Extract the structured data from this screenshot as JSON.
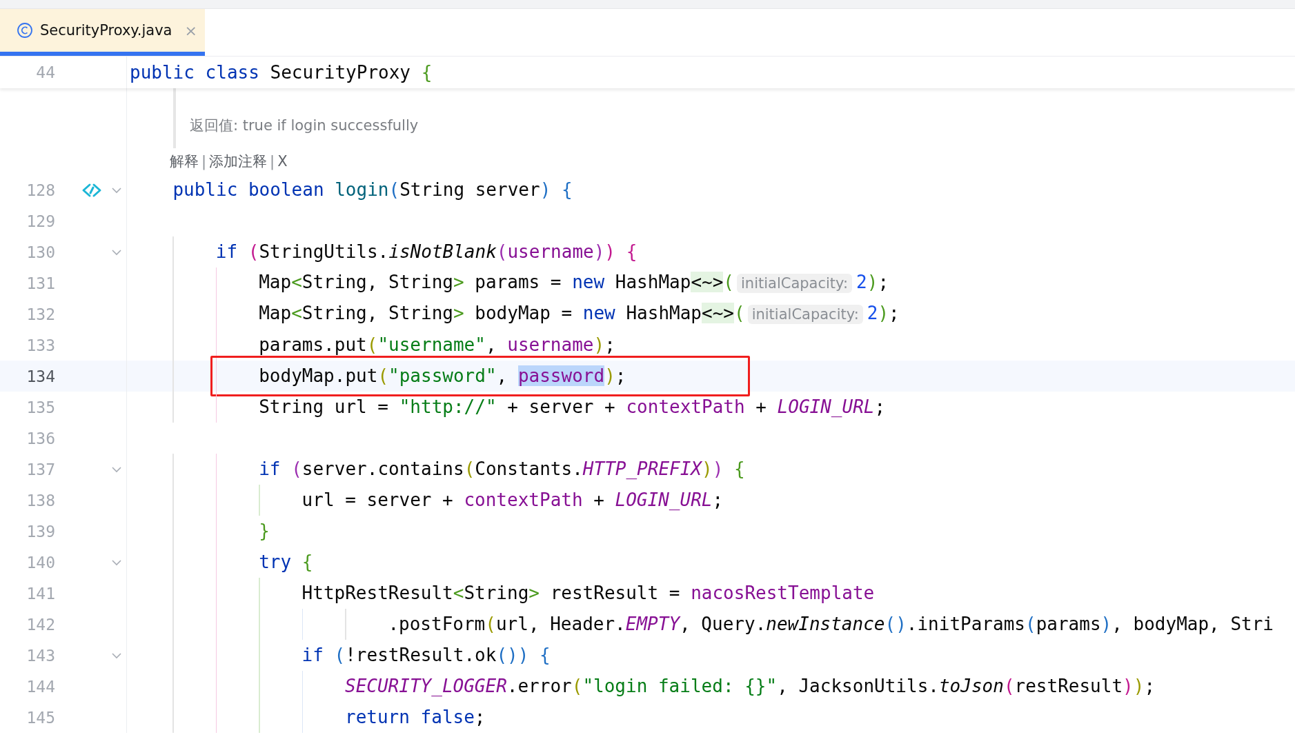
{
  "tabs": [
    {
      "label": "SecurityProxy.java",
      "selected": true,
      "close": "×"
    }
  ],
  "sticky_line": {
    "number": "44",
    "tokens": [
      {
        "text": "public ",
        "kind": "kw"
      },
      {
        "text": "class ",
        "kind": "kw"
      },
      {
        "text": "SecurityProxy ",
        "kind": "plain"
      },
      {
        "text": "{",
        "kind": "bgreen"
      }
    ]
  },
  "doc": {
    "text": "返回值: true if login successfully"
  },
  "inlay_actions": [
    {
      "text": "解释",
      "kind": "link"
    },
    {
      "text": "|",
      "kind": "sep"
    },
    {
      "text": "添加注释",
      "kind": "link"
    },
    {
      "text": "|",
      "kind": "sep"
    },
    {
      "text": "X",
      "kind": "link"
    }
  ],
  "rows": [
    {
      "number": "128",
      "fold": true,
      "marker": true,
      "current": false,
      "boxed": false,
      "tokens": [
        {
          "text": "    public ",
          "kind": "kw"
        },
        {
          "text": "boolean ",
          "kind": "kw"
        },
        {
          "text": "login",
          "kind": "fn"
        },
        {
          "text": "(",
          "kind": "bblue"
        },
        {
          "text": "String server",
          "kind": "plain"
        },
        {
          "text": ")",
          "kind": "bblue"
        },
        {
          "text": " {",
          "kind": "bblue"
        }
      ]
    },
    {
      "number": "129",
      "fold": false,
      "marker": false,
      "current": false,
      "boxed": false,
      "tokens": []
    },
    {
      "number": "130",
      "fold": true,
      "marker": false,
      "current": false,
      "boxed": false,
      "tokens": [
        {
          "text": "        if ",
          "kind": "kw"
        },
        {
          "text": "(",
          "kind": "bpink"
        },
        {
          "text": "StringUtils.",
          "kind": "plain"
        },
        {
          "text": "isNotBlank",
          "kind": "ital"
        },
        {
          "text": "(",
          "kind": "bpurple"
        },
        {
          "text": "username",
          "kind": "field"
        },
        {
          "text": ")",
          "kind": "bpurple"
        },
        {
          "text": ")",
          "kind": "bpink"
        },
        {
          "text": " {",
          "kind": "bpink"
        }
      ]
    },
    {
      "number": "131",
      "fold": false,
      "marker": false,
      "current": false,
      "boxed": false,
      "tokens": [
        {
          "text": "            Map",
          "kind": "plain"
        },
        {
          "text": "<",
          "kind": "bgreen"
        },
        {
          "text": "String, String",
          "kind": "plain"
        },
        {
          "text": ">",
          "kind": "bgreen"
        },
        {
          "text": " params = ",
          "kind": "plain"
        },
        {
          "text": "new ",
          "kind": "kw"
        },
        {
          "text": "HashMap",
          "kind": "plain"
        },
        {
          "text": "<~>",
          "kind": "diamond"
        },
        {
          "text": "(",
          "kind": "bgreen"
        },
        {
          "text": "initialCapacity:",
          "kind": "hint"
        },
        {
          "text": "2",
          "kind": "num"
        },
        {
          "text": ")",
          "kind": "bgreen"
        },
        {
          "text": ";",
          "kind": "plain"
        }
      ]
    },
    {
      "number": "132",
      "fold": false,
      "marker": false,
      "current": false,
      "boxed": false,
      "tokens": [
        {
          "text": "            Map",
          "kind": "plain"
        },
        {
          "text": "<",
          "kind": "bgreen"
        },
        {
          "text": "String, String",
          "kind": "plain"
        },
        {
          "text": ">",
          "kind": "bgreen"
        },
        {
          "text": " bodyMap = ",
          "kind": "plain"
        },
        {
          "text": "new ",
          "kind": "kw"
        },
        {
          "text": "HashMap",
          "kind": "plain"
        },
        {
          "text": "<~>",
          "kind": "diamond"
        },
        {
          "text": "(",
          "kind": "bgreen"
        },
        {
          "text": "initialCapacity:",
          "kind": "hint"
        },
        {
          "text": "2",
          "kind": "num"
        },
        {
          "text": ")",
          "kind": "bgreen"
        },
        {
          "text": ";",
          "kind": "plain"
        }
      ]
    },
    {
      "number": "133",
      "fold": false,
      "marker": false,
      "current": false,
      "boxed": false,
      "tokens": [
        {
          "text": "            params.put",
          "kind": "plain"
        },
        {
          "text": "(",
          "kind": "bolive"
        },
        {
          "text": "\"username\"",
          "kind": "str"
        },
        {
          "text": ", ",
          "kind": "plain"
        },
        {
          "text": "username",
          "kind": "field"
        },
        {
          "text": ")",
          "kind": "bolive"
        },
        {
          "text": ";",
          "kind": "plain"
        }
      ]
    },
    {
      "number": "134",
      "fold": false,
      "marker": false,
      "current": true,
      "boxed": true,
      "tokens": [
        {
          "text": "            bodyMap.put",
          "kind": "plain"
        },
        {
          "text": "(",
          "kind": "bolive"
        },
        {
          "text": "\"password\"",
          "kind": "str"
        },
        {
          "text": ", ",
          "kind": "plain"
        },
        {
          "text": "password",
          "kind": "sel"
        },
        {
          "text": ")",
          "kind": "bolive"
        },
        {
          "text": ";",
          "kind": "plain"
        }
      ]
    },
    {
      "number": "135",
      "fold": false,
      "marker": false,
      "current": false,
      "boxed": false,
      "tokens": [
        {
          "text": "            String url = ",
          "kind": "plain"
        },
        {
          "text": "\"http://\"",
          "kind": "str"
        },
        {
          "text": " + server + ",
          "kind": "plain"
        },
        {
          "text": "contextPath",
          "kind": "field"
        },
        {
          "text": " + ",
          "kind": "plain"
        },
        {
          "text": "LOGIN_URL",
          "kind": "konst"
        },
        {
          "text": ";",
          "kind": "plain"
        }
      ]
    },
    {
      "number": "136",
      "fold": false,
      "marker": false,
      "current": false,
      "boxed": false,
      "tokens": []
    },
    {
      "number": "137",
      "fold": true,
      "marker": false,
      "current": false,
      "boxed": false,
      "tokens": [
        {
          "text": "            if ",
          "kind": "kw"
        },
        {
          "text": "(",
          "kind": "bpurple"
        },
        {
          "text": "server.contains",
          "kind": "plain"
        },
        {
          "text": "(",
          "kind": "bolive"
        },
        {
          "text": "Constants.",
          "kind": "plain"
        },
        {
          "text": "HTTP_PREFIX",
          "kind": "konst"
        },
        {
          "text": ")",
          "kind": "bolive"
        },
        {
          "text": ")",
          "kind": "bpurple"
        },
        {
          "text": " {",
          "kind": "bgreen"
        }
      ]
    },
    {
      "number": "138",
      "fold": false,
      "marker": false,
      "current": false,
      "boxed": false,
      "tokens": [
        {
          "text": "                url = server + ",
          "kind": "plain"
        },
        {
          "text": "contextPath",
          "kind": "field"
        },
        {
          "text": " + ",
          "kind": "plain"
        },
        {
          "text": "LOGIN_URL",
          "kind": "konst"
        },
        {
          "text": ";",
          "kind": "plain"
        }
      ]
    },
    {
      "number": "139",
      "fold": false,
      "marker": false,
      "current": false,
      "boxed": false,
      "tokens": [
        {
          "text": "            }",
          "kind": "bgreen"
        }
      ]
    },
    {
      "number": "140",
      "fold": true,
      "marker": false,
      "current": false,
      "boxed": false,
      "tokens": [
        {
          "text": "            try ",
          "kind": "kw"
        },
        {
          "text": "{",
          "kind": "bgreen"
        }
      ]
    },
    {
      "number": "141",
      "fold": false,
      "marker": false,
      "current": false,
      "boxed": false,
      "tokens": [
        {
          "text": "                HttpRestResult",
          "kind": "plain"
        },
        {
          "text": "<",
          "kind": "bgreen"
        },
        {
          "text": "String",
          "kind": "plain"
        },
        {
          "text": ">",
          "kind": "bgreen"
        },
        {
          "text": " restResult = ",
          "kind": "plain"
        },
        {
          "text": "nacosRestTemplate",
          "kind": "field"
        }
      ]
    },
    {
      "number": "142",
      "fold": false,
      "marker": false,
      "current": false,
      "boxed": false,
      "tokens": [
        {
          "text": "                        .postForm",
          "kind": "plain"
        },
        {
          "text": "(",
          "kind": "bolive"
        },
        {
          "text": "url, Header.",
          "kind": "plain"
        },
        {
          "text": "EMPTY",
          "kind": "konst"
        },
        {
          "text": ", Query.",
          "kind": "plain"
        },
        {
          "text": "newInstance",
          "kind": "ital"
        },
        {
          "text": "()",
          "kind": "bblue"
        },
        {
          "text": ".initParams",
          "kind": "plain"
        },
        {
          "text": "(",
          "kind": "bblue"
        },
        {
          "text": "params",
          "kind": "plain"
        },
        {
          "text": ")",
          "kind": "bblue"
        },
        {
          "text": ", bodyMap, Stri",
          "kind": "plain"
        }
      ]
    },
    {
      "number": "143",
      "fold": true,
      "marker": false,
      "current": false,
      "boxed": false,
      "tokens": [
        {
          "text": "                if ",
          "kind": "kw"
        },
        {
          "text": "(",
          "kind": "bblue"
        },
        {
          "text": "!restResult.ok",
          "kind": "plain"
        },
        {
          "text": "()",
          "kind": "bblue"
        },
        {
          "text": ")",
          "kind": "bblue"
        },
        {
          "text": " {",
          "kind": "bblue"
        }
      ]
    },
    {
      "number": "144",
      "fold": false,
      "marker": false,
      "current": false,
      "boxed": false,
      "tokens": [
        {
          "text": "                    SECURITY_LOGGER",
          "kind": "konst"
        },
        {
          "text": ".error",
          "kind": "plain"
        },
        {
          "text": "(",
          "kind": "bolive"
        },
        {
          "text": "\"login failed: {}\"",
          "kind": "str"
        },
        {
          "text": ", JacksonUtils.",
          "kind": "plain"
        },
        {
          "text": "toJson",
          "kind": "ital"
        },
        {
          "text": "(",
          "kind": "bpink"
        },
        {
          "text": "restResult",
          "kind": "plain"
        },
        {
          "text": ")",
          "kind": "bpink"
        },
        {
          "text": ")",
          "kind": "bolive"
        },
        {
          "text": ";",
          "kind": "plain"
        }
      ]
    },
    {
      "number": "145",
      "fold": false,
      "marker": false,
      "current": false,
      "boxed": false,
      "tokens": [
        {
          "text": "                    return ",
          "kind": "kw"
        },
        {
          "text": "false",
          "kind": "kw"
        },
        {
          "text": ";",
          "kind": "plain"
        }
      ]
    }
  ]
}
